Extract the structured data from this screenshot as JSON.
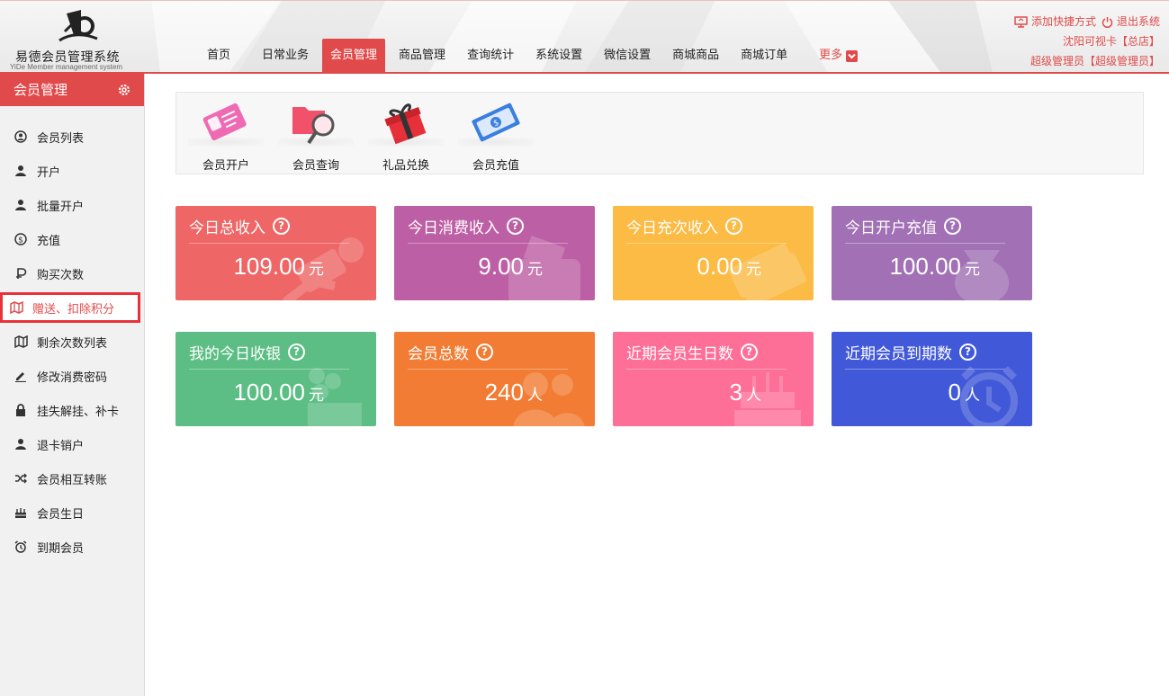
{
  "brand": {
    "title": "易德会员管理系统",
    "subtitle": "YiDe Member management system"
  },
  "nav": {
    "items": [
      "首页",
      "日常业务",
      "会员管理",
      "商品管理",
      "查询统计",
      "系统设置",
      "微信设置",
      "商城商品",
      "商城订单"
    ],
    "active_index": 2,
    "more_label": "更多"
  },
  "topright": {
    "add_shortcut": "添加快捷方式",
    "logout": "退出系统",
    "store": "沈阳可视卡【总店】",
    "user": "超级管理员【超级管理员】"
  },
  "sidebar": {
    "title": "会员管理",
    "items": [
      {
        "label": "会员列表",
        "icon": "user-circle-icon"
      },
      {
        "label": "开户",
        "icon": "user-icon"
      },
      {
        "label": "批量开户",
        "icon": "user-icon"
      },
      {
        "label": "充值",
        "icon": "dollar-circle-icon"
      },
      {
        "label": "购买次数",
        "icon": "p-coin-icon"
      },
      {
        "label": "赠送、扣除积分",
        "icon": "map-icon",
        "active": true
      },
      {
        "label": "剩余次数列表",
        "icon": "map-icon"
      },
      {
        "label": "修改消费密码",
        "icon": "pencil-icon"
      },
      {
        "label": "挂失解挂、补卡",
        "icon": "lock-icon"
      },
      {
        "label": "退卡销户",
        "icon": "user-icon"
      },
      {
        "label": "会员相互转账",
        "icon": "shuffle-icon"
      },
      {
        "label": "会员生日",
        "icon": "cake-icon"
      },
      {
        "label": "到期会员",
        "icon": "alarm-clock-icon"
      }
    ]
  },
  "shortcuts": [
    {
      "label": "会员开户",
      "icon": "member-card-icon"
    },
    {
      "label": "会员查询",
      "icon": "folder-search-icon"
    },
    {
      "label": "礼品兑换",
      "icon": "gift-icon"
    },
    {
      "label": "会员充值",
      "icon": "money-icon"
    }
  ],
  "stats": [
    {
      "title": "今日总收入",
      "value": "109.00",
      "unit": "元",
      "color": "#ee6666",
      "icon": "money-hand-icon"
    },
    {
      "title": "今日消费收入",
      "value": "9.00",
      "unit": "元",
      "color": "#bd5fa4",
      "icon": "wallet-icon"
    },
    {
      "title": "今日充次收入",
      "value": "0.00",
      "unit": "元",
      "color": "#fbbb44",
      "icon": "cash-stack-icon"
    },
    {
      "title": "今日开户充值",
      "value": "100.00",
      "unit": "元",
      "color": "#a170b5",
      "icon": "money-bag-icon"
    },
    {
      "title": "我的今日收银",
      "value": "100.00",
      "unit": "元",
      "color": "#5cbe84",
      "icon": "cashier-icon"
    },
    {
      "title": "会员总数",
      "value": "240",
      "unit": "人",
      "color": "#f27c33",
      "icon": "users-icon"
    },
    {
      "title": "近期会员生日数",
      "value": "3",
      "unit": "人",
      "color": "#fe6f98",
      "icon": "birthday-cake-icon"
    },
    {
      "title": "近期会员到期数",
      "value": "0",
      "unit": "人",
      "color": "#4159d9",
      "icon": "alarm-clock-icon"
    }
  ]
}
